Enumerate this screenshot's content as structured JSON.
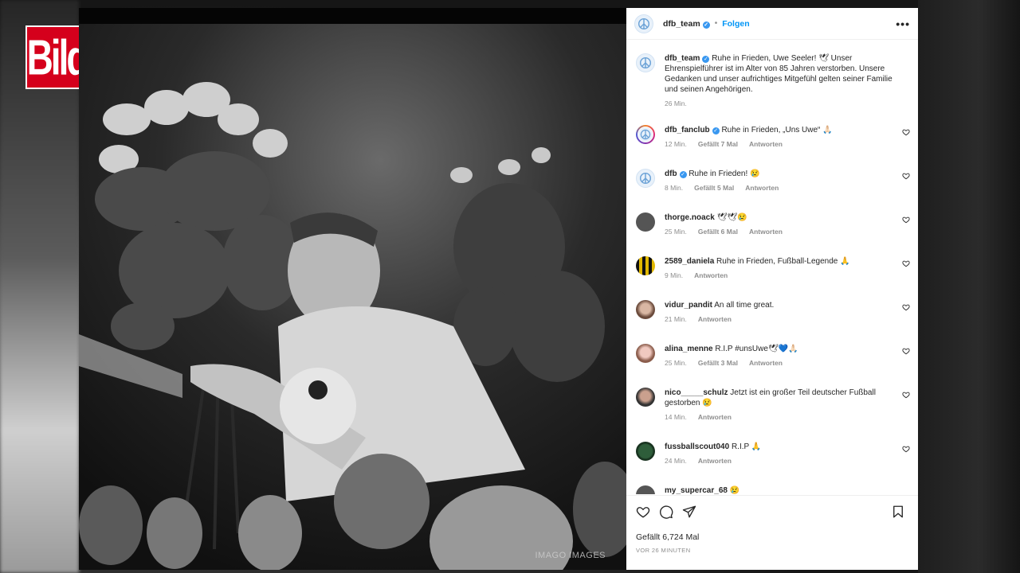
{
  "brand": {
    "logo_text": "Bild"
  },
  "photo": {
    "watermark": "IMAGO IMAGES"
  },
  "post": {
    "username": "dfb_team",
    "follow_label": "Folgen",
    "more_label": "•••",
    "caption": {
      "username": "dfb_team",
      "text": "Ruhe in Frieden, Uwe Seeler! 🕊 Unser Ehrenspielführer ist im Alter von 85 Jahren verstorben. Unsere Gedanken und unser aufrichtiges Mitgefühl gelten seiner Familie und seinen Angehörigen.",
      "time": "26 Min."
    },
    "comments": [
      {
        "user": "dfb_fanclub",
        "verified": true,
        "text": "Ruhe in Frieden, „Uns Uwe“ 🙏🏻",
        "time": "12 Min.",
        "likes": "Gefällt 7 Mal",
        "reply": "Antworten"
      },
      {
        "user": "dfb",
        "verified": true,
        "text": "Ruhe in Frieden! 😢",
        "time": "8 Min.",
        "likes": "Gefällt 5 Mal",
        "reply": "Antworten"
      },
      {
        "user": "thorge.noack",
        "verified": false,
        "text": "🕊🕊😢",
        "time": "25 Min.",
        "likes": "Gefällt 6 Mal",
        "reply": "Antworten"
      },
      {
        "user": "2589_daniela",
        "verified": false,
        "text": "Ruhe in Frieden, Fußball-Legende 🙏",
        "time": "9 Min.",
        "likes": "",
        "reply": "Antworten"
      },
      {
        "user": "vidur_pandit",
        "verified": false,
        "text": "An all time great.",
        "time": "21 Min.",
        "likes": "",
        "reply": "Antworten"
      },
      {
        "user": "alina_menne",
        "verified": false,
        "text": "R.I.P #unsUwe🕊💙🙏🏻",
        "time": "25 Min.",
        "likes": "Gefällt 3 Mal",
        "reply": "Antworten"
      },
      {
        "user": "nico_____schulz",
        "verified": false,
        "text": "Jetzt ist ein großer Teil deutscher Fußball gestorben 😢",
        "time": "14 Min.",
        "likes": "",
        "reply": "Antworten"
      },
      {
        "user": "fussballscout040",
        "verified": false,
        "text": "R.I.P 🙏",
        "time": "24 Min.",
        "likes": "",
        "reply": "Antworten"
      },
      {
        "user": "my_supercar_68",
        "verified": false,
        "text": "😢",
        "time": "",
        "likes": "",
        "reply": ""
      }
    ],
    "likes_total": "Gefällt 6,724 Mal",
    "posted_ago": "VOR 26 MINUTEN"
  },
  "icons": [
    "peace-icon",
    "verified-icon",
    "heart-icon",
    "comment-icon",
    "share-icon",
    "bookmark-icon"
  ],
  "colors": {
    "accent": "#0095f6",
    "bild_red": "#d5001c",
    "verified": "#3897f0"
  }
}
